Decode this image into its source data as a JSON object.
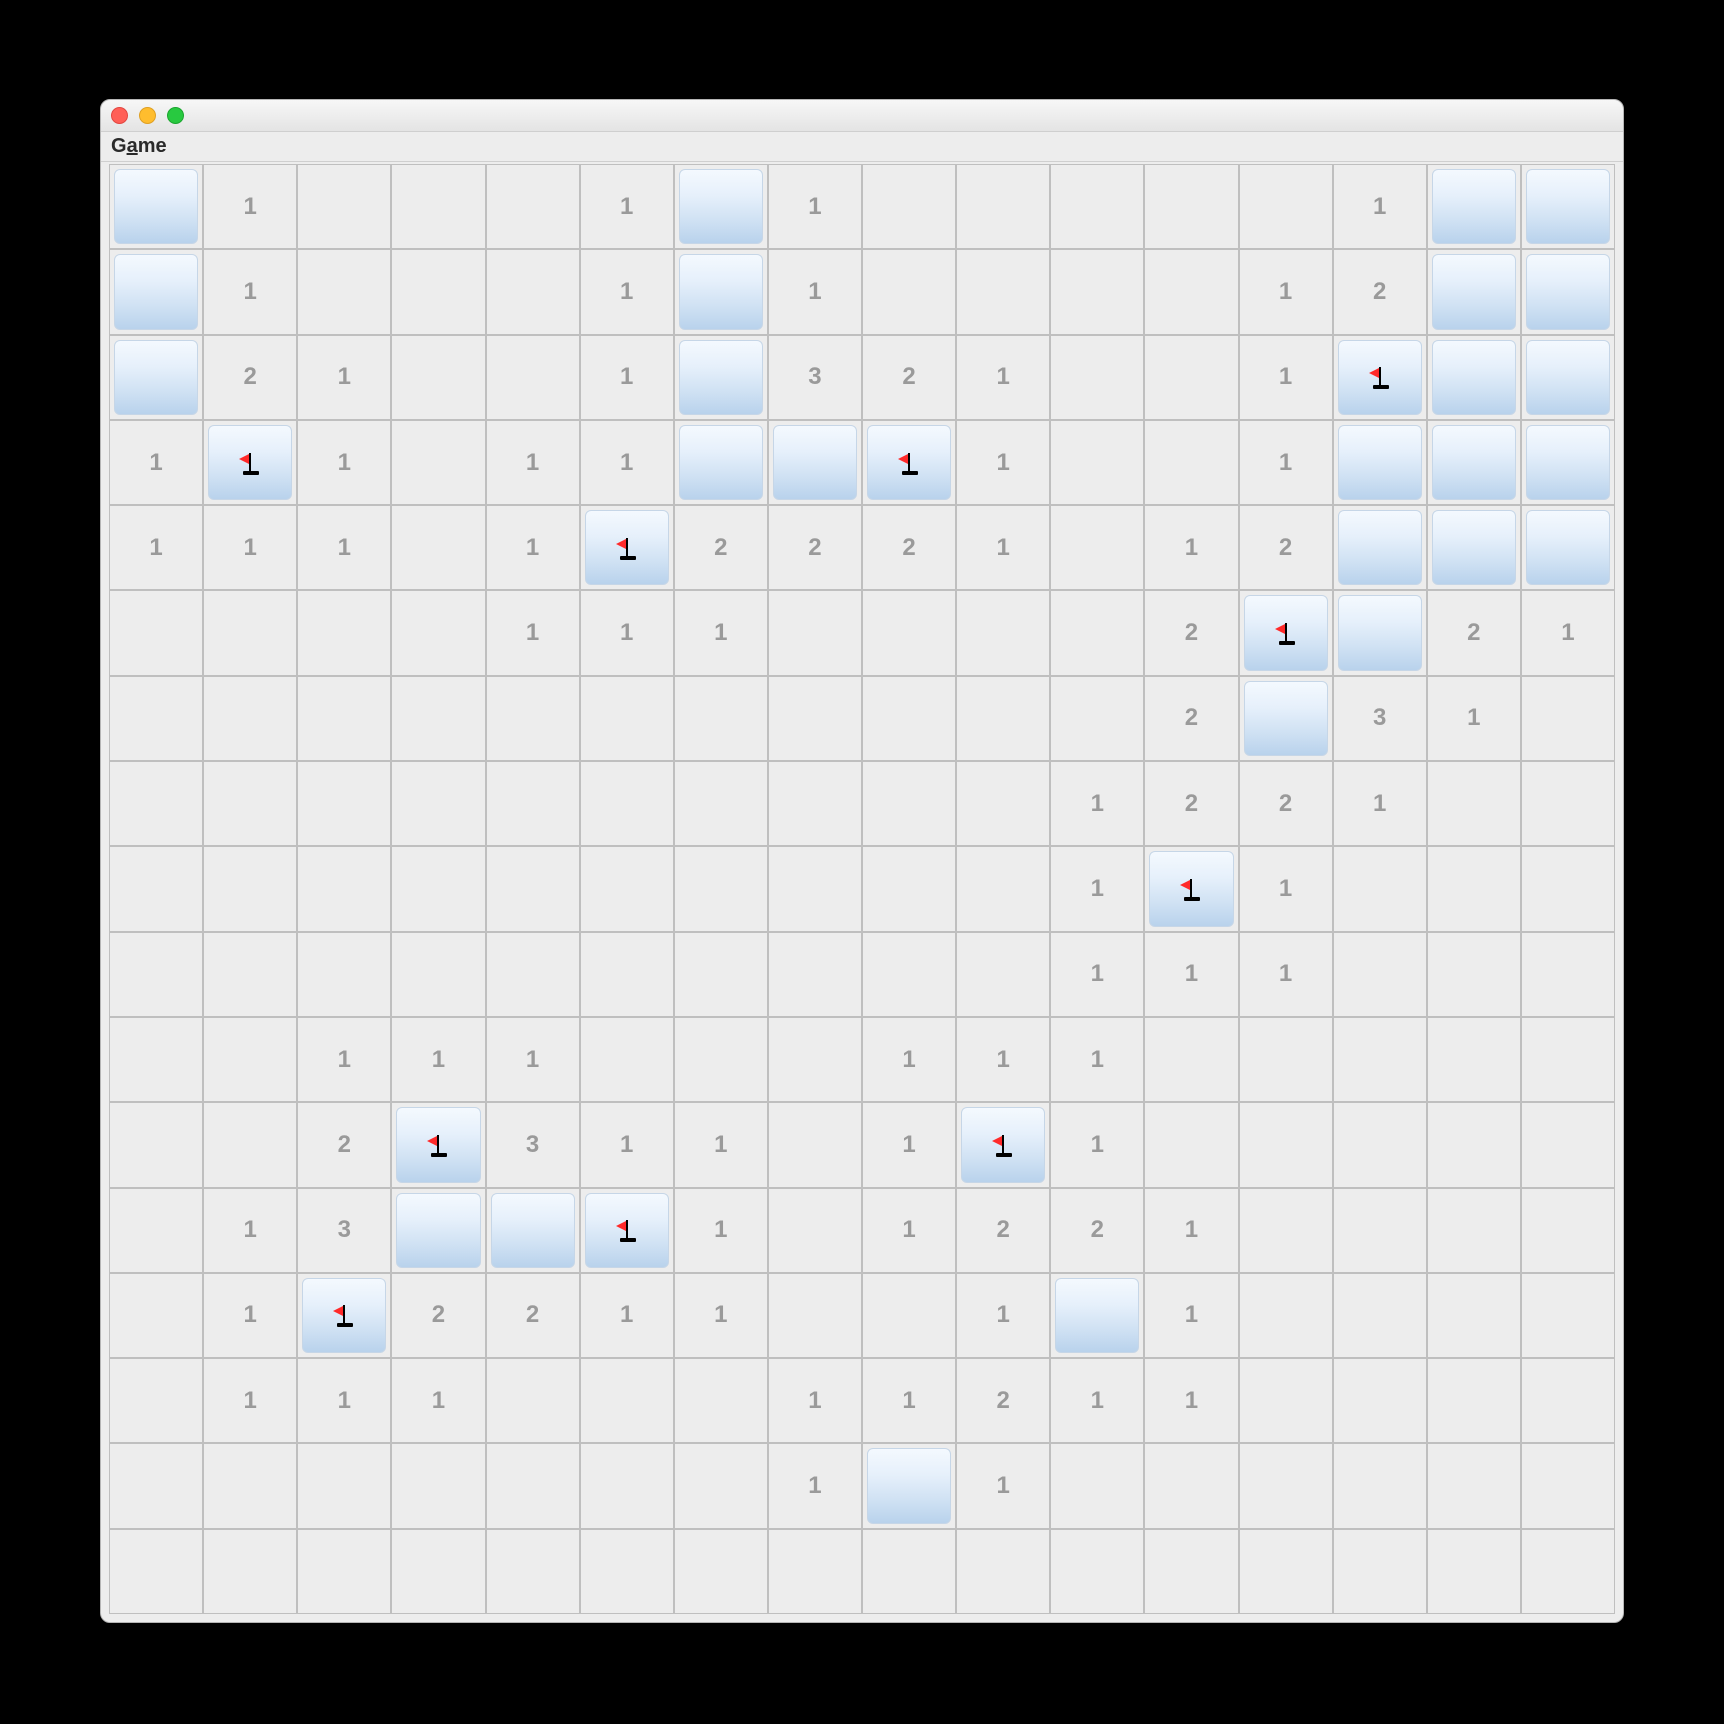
{
  "window": {
    "menu_label_pre": "G",
    "menu_label_underline": "a",
    "menu_label_post": "me"
  },
  "board": {
    "rows": 17,
    "cols": 16,
    "grid": [
      [
        "C",
        "1",
        "",
        "",
        "",
        "1",
        "C",
        "1",
        "",
        "",
        "",
        "",
        "",
        "1",
        "C",
        "C"
      ],
      [
        "C",
        "1",
        "",
        "",
        "",
        "1",
        "C",
        "1",
        "",
        "",
        "",
        "",
        "1",
        "2",
        "C",
        "C"
      ],
      [
        "C",
        "2",
        "1",
        "",
        "",
        "1",
        "C",
        "3",
        "2",
        "1",
        "",
        "",
        "1",
        "F",
        "C",
        "C"
      ],
      [
        "1",
        "F",
        "1",
        "",
        "1",
        "1",
        "C",
        "C",
        "F",
        "1",
        "",
        "",
        "1",
        "C",
        "C",
        "C"
      ],
      [
        "1",
        "1",
        "1",
        "",
        "1",
        "F",
        "2",
        "2",
        "2",
        "1",
        "",
        "1",
        "2",
        "C",
        "C",
        "C"
      ],
      [
        "",
        "",
        "",
        "",
        "1",
        "1",
        "1",
        "",
        "",
        "",
        "",
        "2",
        "F",
        "C",
        "2",
        "1"
      ],
      [
        "",
        "",
        "",
        "",
        "",
        "",
        "",
        "",
        "",
        "",
        "",
        "2",
        "C",
        "3",
        "1",
        ""
      ],
      [
        "",
        "",
        "",
        "",
        "",
        "",
        "",
        "",
        "",
        "",
        "1",
        "2",
        "2",
        "1",
        "",
        ""
      ],
      [
        "",
        "",
        "",
        "",
        "",
        "",
        "",
        "",
        "",
        "",
        "1",
        "F",
        "1",
        "",
        "",
        ""
      ],
      [
        "",
        "",
        "",
        "",
        "",
        "",
        "",
        "",
        "",
        "",
        "1",
        "1",
        "1",
        "",
        "",
        ""
      ],
      [
        "",
        "",
        "1",
        "1",
        "1",
        "",
        "",
        "",
        "1",
        "1",
        "1",
        "",
        "",
        "",
        "",
        ""
      ],
      [
        "",
        "",
        "2",
        "F",
        "3",
        "1",
        "1",
        "",
        "1",
        "F",
        "1",
        "",
        "",
        "",
        "",
        ""
      ],
      [
        "",
        "1",
        "3",
        "C",
        "C",
        "F",
        "1",
        "",
        "1",
        "2",
        "2",
        "1",
        "",
        "",
        "",
        ""
      ],
      [
        "",
        "1",
        "F",
        "2",
        "2",
        "1",
        "1",
        "",
        "",
        "1",
        "C",
        "1",
        "",
        "",
        "",
        ""
      ],
      [
        "",
        "1",
        "1",
        "1",
        "",
        "",
        "",
        "1",
        "1",
        "2",
        "1",
        "1",
        "",
        "",
        "",
        ""
      ],
      [
        "",
        "",
        "",
        "",
        "",
        "",
        "",
        "1",
        "C",
        "1",
        "",
        "",
        "",
        "",
        "",
        ""
      ],
      [
        "",
        "",
        "",
        "",
        "",
        "",
        "",
        "",
        "",
        "",
        "",
        "",
        "",
        "",
        "",
        ""
      ]
    ]
  }
}
